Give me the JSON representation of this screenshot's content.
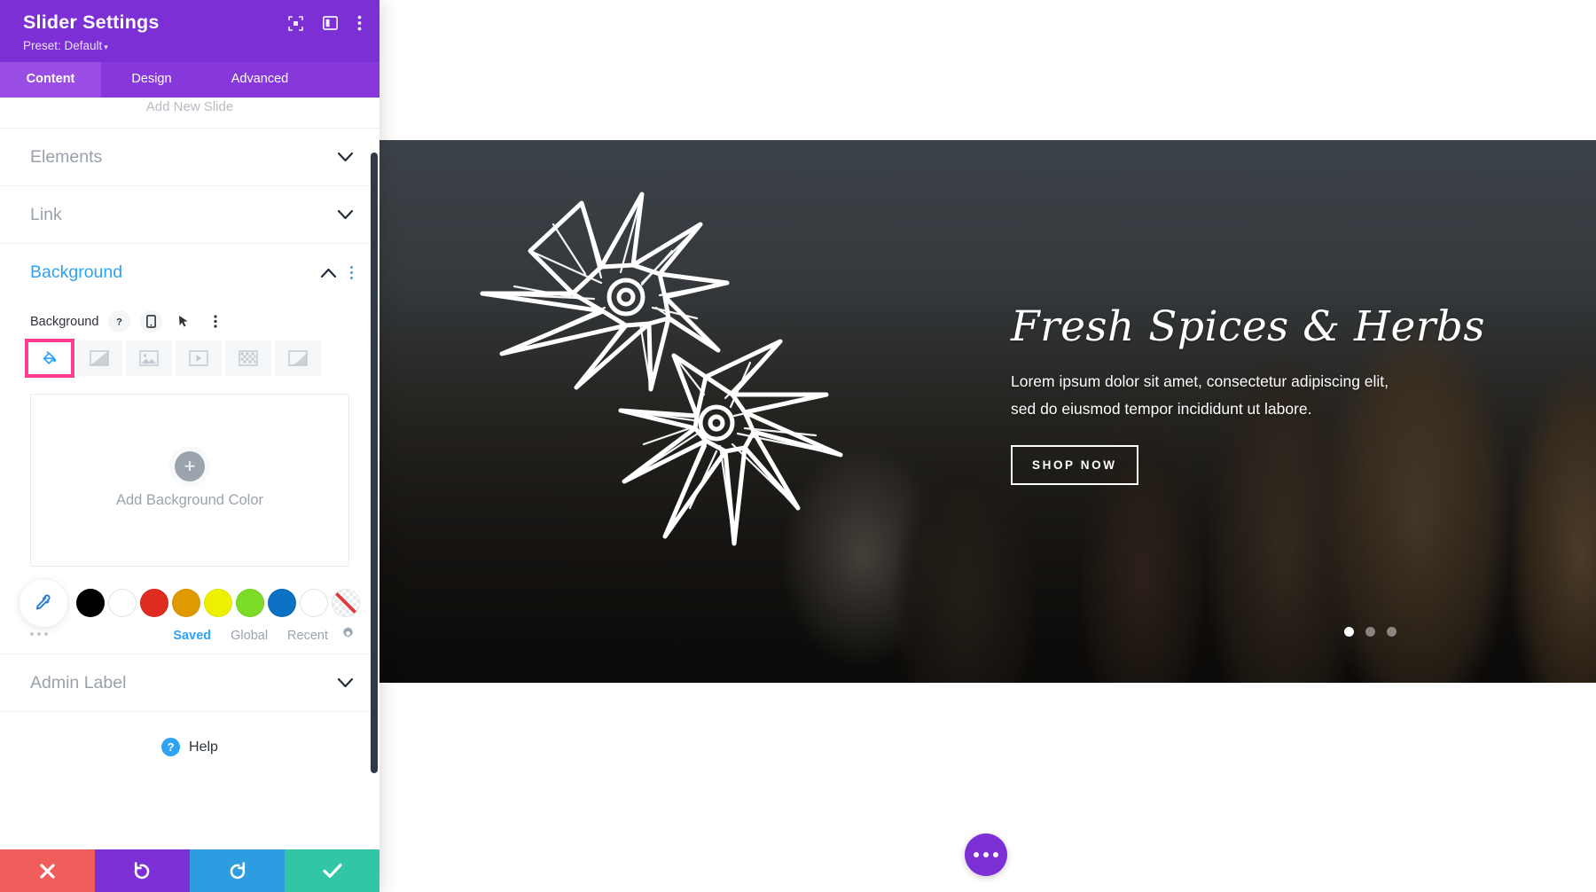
{
  "panel": {
    "title": "Slider Settings",
    "preset": "Preset: Default",
    "header_icons": [
      "fullscreen-icon",
      "layout-toggle-icon",
      "kebab-menu-icon"
    ],
    "tabs": [
      {
        "label": "Content",
        "active": true
      },
      {
        "label": "Design",
        "active": false
      },
      {
        "label": "Advanced",
        "active": false
      }
    ],
    "add_new_slide": "Add New Slide",
    "accordions": [
      {
        "label": "Elements",
        "open": false
      },
      {
        "label": "Link",
        "open": false
      },
      {
        "label": "Background",
        "open": true
      },
      {
        "label": "Admin Label",
        "open": false
      }
    ],
    "background": {
      "section_label": "Background",
      "field_label": "Background",
      "field_icons": [
        "help-icon",
        "responsive-phone-icon",
        "hover-cursor-icon",
        "kebab-menu-icon"
      ],
      "type_tabs": [
        {
          "name": "background-color",
          "selected": true
        },
        {
          "name": "background-gradient",
          "selected": false
        },
        {
          "name": "background-image",
          "selected": false
        },
        {
          "name": "background-video",
          "selected": false
        },
        {
          "name": "background-pattern",
          "selected": false
        },
        {
          "name": "background-mask",
          "selected": false
        }
      ],
      "selection_highlight_color": "#ff3c8d",
      "add_color_label": "Add Background Color",
      "swatches": [
        {
          "name": "black",
          "color": "#000000"
        },
        {
          "name": "white",
          "color": "#ffffff"
        },
        {
          "name": "red",
          "color": "#e02b20"
        },
        {
          "name": "orange",
          "color": "#e09900"
        },
        {
          "name": "yellow",
          "color": "#edf000"
        },
        {
          "name": "green",
          "color": "#7cdb26"
        },
        {
          "name": "blue",
          "color": "#0c71c3"
        },
        {
          "name": "white-outline",
          "color": "#ffffff"
        },
        {
          "name": "transparent",
          "color": "transparent"
        }
      ],
      "palette_tabs": [
        {
          "label": "Saved",
          "active": true
        },
        {
          "label": "Global",
          "active": false
        },
        {
          "label": "Recent",
          "active": false
        }
      ],
      "palette_settings_icon": "gear-icon"
    },
    "help_label": "Help",
    "footer": [
      {
        "name": "cancel",
        "icon": "close-x-icon",
        "color": "#f15d5d"
      },
      {
        "name": "undo",
        "icon": "undo-arrow-icon",
        "color": "#7b2fd4"
      },
      {
        "name": "redo",
        "icon": "redo-arrow-icon",
        "color": "#2e9ce0"
      },
      {
        "name": "save",
        "icon": "checkmark-icon",
        "color": "#33c6a6"
      }
    ]
  },
  "slider": {
    "title": "Fresh Spices & Herbs",
    "body": "Lorem ipsum dolor sit amet, consectetur adipiscing elit, sed do eiusmod tempor incididunt ut labore.",
    "cta": "SHOP NOW",
    "dots": [
      {
        "active": true
      },
      {
        "active": false
      },
      {
        "active": false
      }
    ]
  },
  "theme": {
    "brand_purple": "#7b2fd4",
    "tab_purple": "#8638db",
    "accent_blue": "#2ea3f2",
    "highlight_pink": "#ff3c8d"
  }
}
